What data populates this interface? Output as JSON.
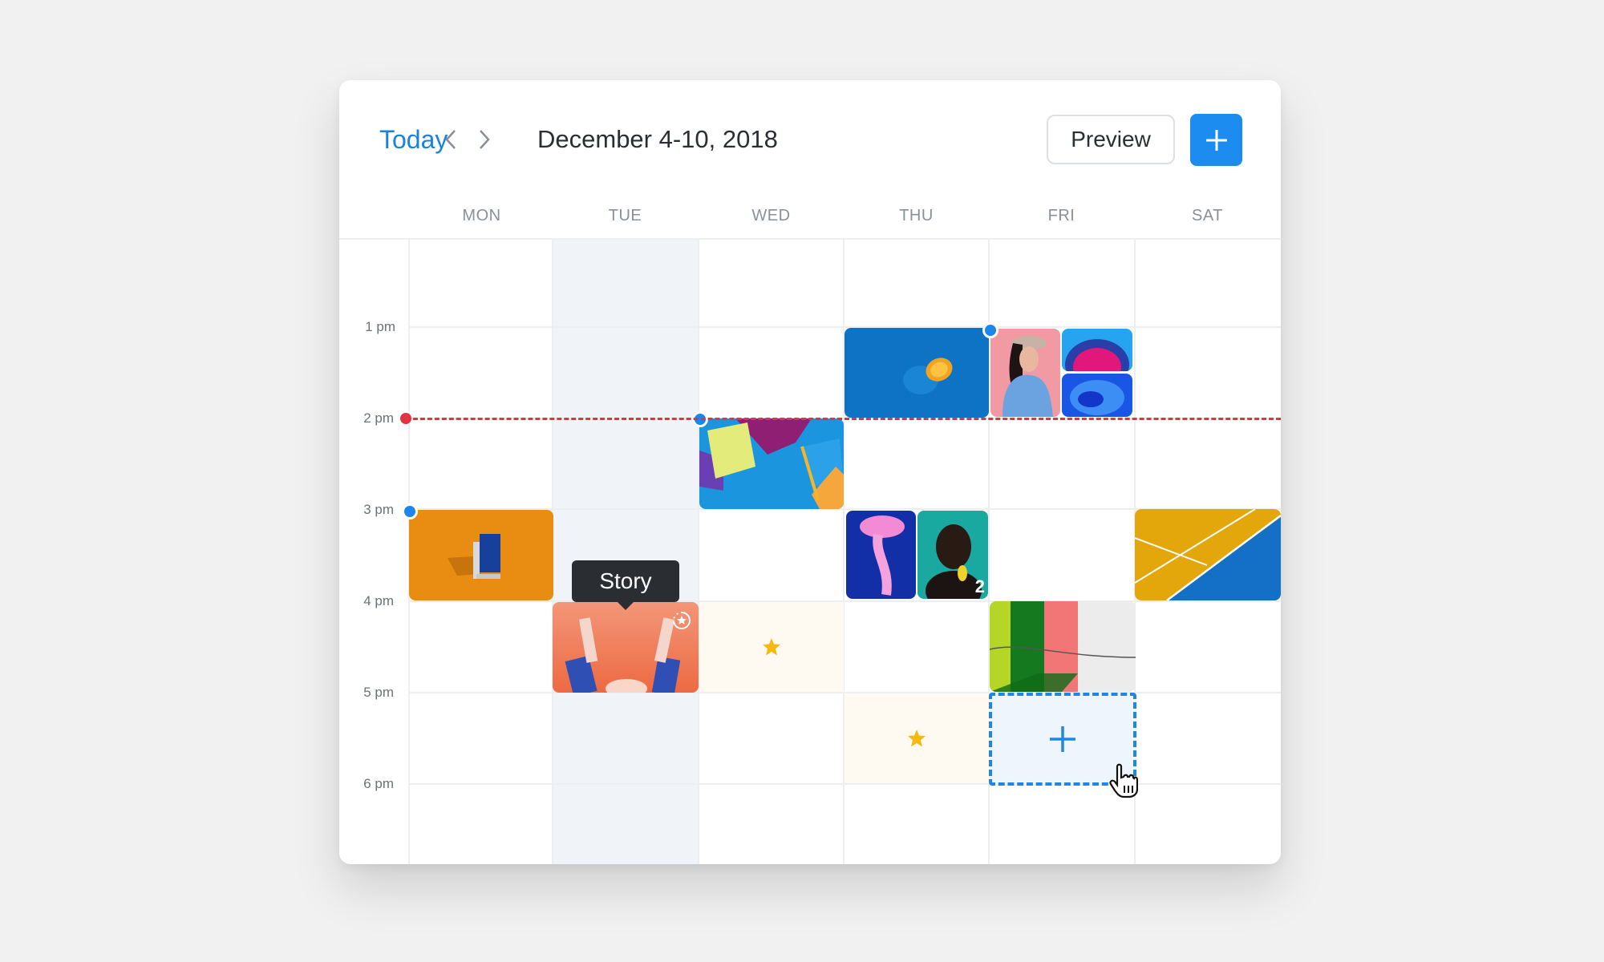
{
  "header": {
    "today_label": "Today",
    "prev_icon": "chevron-left-icon",
    "next_icon": "chevron-right-icon",
    "date_range": "December 4-10, 2018",
    "preview_label": "Preview",
    "add_icon": "plus-icon"
  },
  "days": [
    "MON",
    "TUE",
    "WED",
    "THU",
    "FRI",
    "SAT"
  ],
  "selected_day": "TUE",
  "times": [
    "1 pm",
    "2 pm",
    "3 pm",
    "4 pm",
    "5 pm",
    "6 pm"
  ],
  "now_indicator": {
    "time": "2 pm",
    "color": "#e0353f"
  },
  "posts": [
    {
      "day": "MON",
      "start": "3 pm",
      "kind": "image",
      "subject": "orange-book"
    },
    {
      "day": "TUE",
      "start": "4 pm",
      "kind": "story",
      "subject": "raised-hands",
      "tooltip": "Story"
    },
    {
      "day": "WED",
      "start": "2 pm",
      "kind": "image",
      "subject": "paper-envelopes"
    },
    {
      "day": "WED",
      "start": "4 pm",
      "kind": "best-time-slot",
      "icon": "star-icon"
    },
    {
      "day": "THU",
      "start": "1 pm",
      "kind": "image",
      "subject": "blue-orange"
    },
    {
      "day": "THU",
      "start": "3 pm",
      "kind": "gallery",
      "subjects": [
        "jellyfish",
        "portrait-woman"
      ],
      "more_count": "2"
    },
    {
      "day": "THU",
      "start": "5 pm",
      "kind": "best-time-slot",
      "icon": "star-icon"
    },
    {
      "day": "FRI",
      "start": "1 pm",
      "kind": "gallery",
      "subjects": [
        "pink-woman-cap",
        "pink-blue-ink",
        "blue-ink"
      ]
    },
    {
      "day": "FRI",
      "start": "4 pm",
      "kind": "image",
      "subject": "colored-wall"
    },
    {
      "day": "FRI",
      "start": "5 pm",
      "kind": "new-post-slot",
      "icon": "plus-icon"
    },
    {
      "day": "SAT",
      "start": "3 pm",
      "kind": "image",
      "subject": "sports-court"
    }
  ],
  "colors": {
    "accent": "#1c8cf0",
    "now_line": "#e0353f",
    "star": "#f6b90f",
    "selected_day_bg": "#f0f4f9"
  }
}
